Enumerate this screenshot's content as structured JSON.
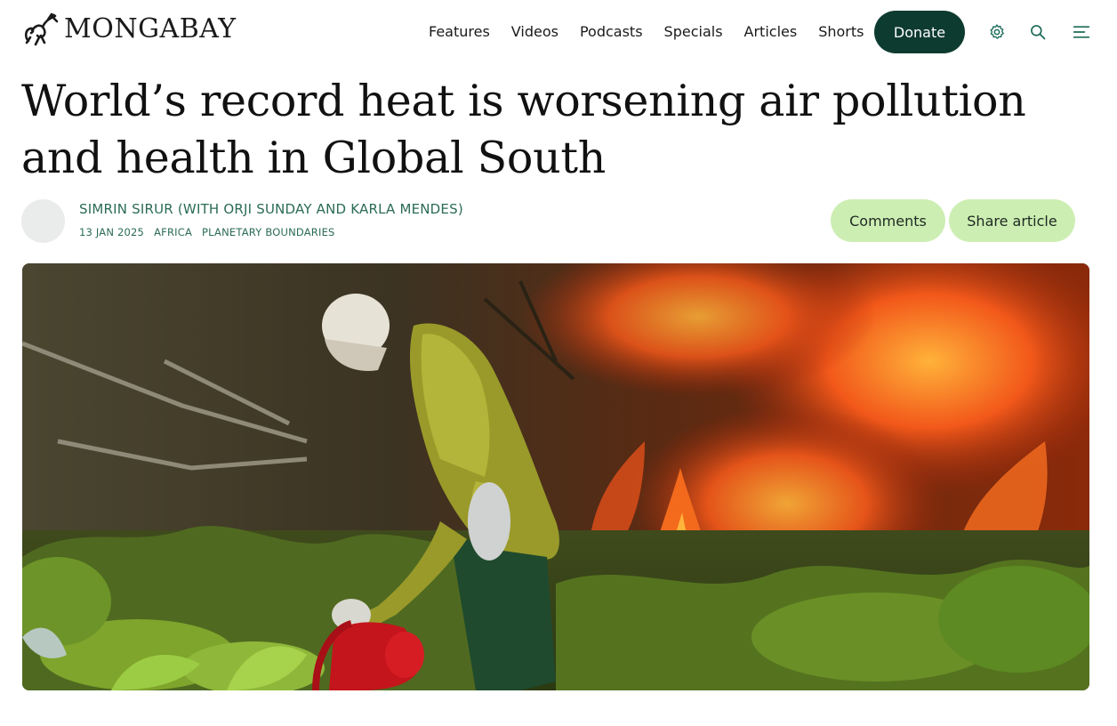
{
  "header": {
    "logo_text": "MONGABAY",
    "nav": [
      {
        "label": "Features"
      },
      {
        "label": "Videos"
      },
      {
        "label": "Podcasts"
      },
      {
        "label": "Specials"
      },
      {
        "label": "Articles"
      },
      {
        "label": "Shorts"
      }
    ],
    "donate_label": "Donate",
    "icons": [
      "settings-icon",
      "search-icon",
      "menu-icon"
    ]
  },
  "article": {
    "title": "World’s record heat is worsening air pollution and health in Global South",
    "author": "SIMRIN SIRUR (WITH ORJI SUNDAY AND KARLA MENDES)",
    "date": "13 JAN 2025",
    "tags": [
      "AFRICA",
      "PLANETARY BOUNDARIES"
    ],
    "comments_label": "Comments",
    "share_label": "Share article"
  },
  "colors": {
    "brand_dark": "#0e3b30",
    "accent_green": "#2b6b57",
    "pill_bg": "#cdeeb3"
  }
}
